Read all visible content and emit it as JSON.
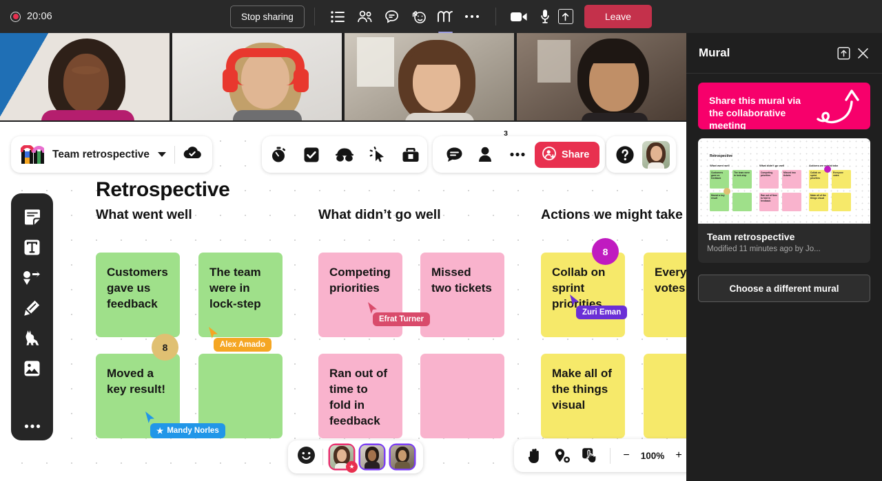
{
  "meeting_bar": {
    "recording_time": "20:06",
    "stop_sharing_label": "Stop sharing",
    "leave_label": "Leave",
    "icons": [
      {
        "name": "agenda-list-icon",
        "label": "Agenda"
      },
      {
        "name": "people-icon",
        "label": "People"
      },
      {
        "name": "chat-icon",
        "label": "Chat"
      },
      {
        "name": "raise-hand-reactions-icon",
        "label": "Reactions"
      },
      {
        "name": "mural-app-icon",
        "label": "Mural",
        "active": true
      },
      {
        "name": "more-options-icon",
        "label": "More"
      },
      {
        "name": "camera-icon",
        "label": "Camera"
      },
      {
        "name": "microphone-icon",
        "label": "Microphone"
      },
      {
        "name": "share-screen-icon",
        "label": "Share"
      }
    ]
  },
  "video_tiles": [
    {
      "name": "participant-tile-1"
    },
    {
      "name": "participant-tile-2"
    },
    {
      "name": "participant-tile-3"
    },
    {
      "name": "participant-tile-4"
    }
  ],
  "mural_toolbar": {
    "mural_name": "Team retrospective",
    "saved_label": "Saved",
    "tools": [
      {
        "name": "timer-icon",
        "label": "Timer"
      },
      {
        "name": "checkbox-voting-icon",
        "label": "Voting"
      },
      {
        "name": "private-mode-icon",
        "label": "Private mode"
      },
      {
        "name": "summon-cursor-icon",
        "label": "Summon"
      },
      {
        "name": "toolkit-icon",
        "label": "Toolkit"
      }
    ],
    "comment_icon": "comment-icon",
    "people_icon": "people-icon",
    "people_count": "3",
    "more_icon": "more-options-icon",
    "share_label": "Share",
    "help_icon": "help-question-icon",
    "avatar_name": "user-avatar"
  },
  "left_rail": [
    {
      "name": "sticky-note-tool",
      "label": "Sticky note"
    },
    {
      "name": "text-tool",
      "label": "Text"
    },
    {
      "name": "shapes-connectors-tool",
      "label": "Shapes and connectors"
    },
    {
      "name": "pen-tool",
      "label": "Pen"
    },
    {
      "name": "icons-llama-tool",
      "label": "Icons"
    },
    {
      "name": "image-tool",
      "label": "Image"
    },
    {
      "name": "more-tools",
      "label": "More"
    }
  ],
  "board": {
    "title": "Retrospective",
    "columns": [
      {
        "heading": "What went well"
      },
      {
        "heading": "What didn’t go well"
      },
      {
        "heading": "Actions we might take"
      }
    ],
    "notes": [
      {
        "text": "Customers gave us feedback",
        "color": "green",
        "column": 0
      },
      {
        "text": "The team were in lock-step",
        "color": "green",
        "column": 0
      },
      {
        "text": "Moved a key result!",
        "color": "green",
        "column": 0
      },
      {
        "text": "",
        "color": "green",
        "column": 0
      },
      {
        "text": "Competing priorities",
        "color": "pink",
        "column": 1
      },
      {
        "text": "Missed two tickets",
        "color": "pink",
        "column": 1
      },
      {
        "text": "Ran out of time to fold in feedback",
        "color": "pink",
        "column": 1
      },
      {
        "text": "",
        "color": "pink",
        "column": 1
      },
      {
        "text": "Collab on sprint priorities",
        "color": "yellow",
        "column": 2
      },
      {
        "text": "Everyone votes",
        "color": "yellow",
        "column": 2
      },
      {
        "text": "Make all of the things visual",
        "color": "yellow",
        "column": 2
      },
      {
        "text": "",
        "color": "yellow",
        "column": 2
      }
    ],
    "vote_badges": [
      {
        "count": "8",
        "color": "#e0c072",
        "on": "Moved a key result!"
      },
      {
        "count": "8",
        "color": "#c01bc0",
        "on": "Collab on sprint priorities"
      }
    ],
    "cursors": [
      {
        "label": "Alex Amado",
        "color": "#f5a623",
        "star": false
      },
      {
        "label": "Efrat Turner",
        "color": "#d94b6b",
        "star": false
      },
      {
        "label": "Mandy Norles",
        "color": "#2196e8",
        "star": true
      },
      {
        "label": "Zuri Eman",
        "color": "#6a2fd6",
        "star": false
      }
    ]
  },
  "reaction_bar": {
    "emoji_icon": "smiley-reaction-icon",
    "avatars": [
      {
        "name": "reaction-avatar-1",
        "border": "#e8306f",
        "starred": true
      },
      {
        "name": "reaction-avatar-2",
        "border": "#7b3ff2",
        "starred": false
      },
      {
        "name": "reaction-avatar-3",
        "border": "#7b3ff2",
        "starred": false
      }
    ]
  },
  "zoom_bar": {
    "hand_icon": "pan-hand-icon",
    "locate_icon": "find-people-icon",
    "select_icon": "select-touch-icon",
    "minus_label": "−",
    "zoom_level": "100%",
    "plus_label": "+"
  },
  "panel": {
    "title": "Mural",
    "popout_icon": "pop-out-icon",
    "close_icon": "close-icon",
    "promo_text": "Share this mural via the collaborative meeting",
    "promo_color": "#f7006b",
    "card": {
      "title": "Team retrospective",
      "subtitle": "Modified 11 minutes ago by Jo...",
      "thumb_title": "Retrospective",
      "thumb_columns": [
        "What went well",
        "What didn't go well",
        "Actions we might take"
      ],
      "thumb_notes": [
        "Customers gave us feedback",
        "The team were in lock-step",
        "Competing priorities",
        "Missed two tickets",
        "Collab on sprint priorities",
        "Everyone votes",
        "Moved a key result",
        "",
        "Ran out of time to fold in feedback",
        "",
        "Make all of the things visual",
        ""
      ]
    },
    "choose_label": "Choose a different mural"
  }
}
